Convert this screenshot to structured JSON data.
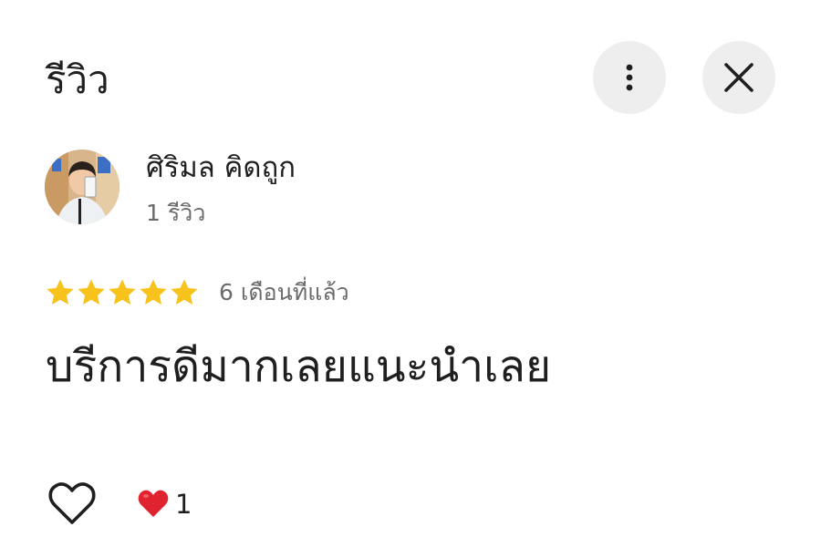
{
  "header": {
    "title": "รีวิว",
    "more_icon": "more-vert-icon",
    "close_icon": "close-icon"
  },
  "review": {
    "author": {
      "name": "ศิริมล คิดถูก",
      "meta": "1 รีวิว",
      "avatar": "avatar-photo"
    },
    "rating": 5,
    "rating_max": 5,
    "star_color": "#f7c21b",
    "date": "6 เดือนที่แล้ว",
    "text": "บรีการดีมากเลยแนะนำเลย",
    "reactions": {
      "like_icon": "heart-outline-icon",
      "emoji": "red-heart-icon",
      "count": "1"
    }
  }
}
